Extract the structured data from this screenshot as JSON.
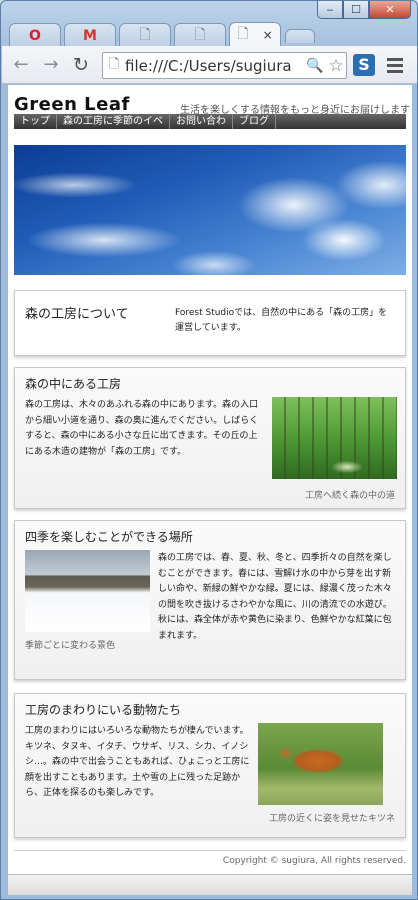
{
  "browser": {
    "tabs": [
      {
        "icon": "opera-icon"
      },
      {
        "icon": "gmail-icon"
      },
      {
        "icon": "page-icon"
      },
      {
        "icon": "page-icon"
      },
      {
        "icon": "page-icon",
        "active": true
      },
      {
        "icon": "new-tab"
      }
    ],
    "tab_close": "×",
    "address": "file:///C:/Users/sugiura",
    "window_buttons": {
      "minimize": "‒",
      "maximize": "☐",
      "close": "✕"
    }
  },
  "site": {
    "logo": "Green Leaf",
    "tagline": "生活を楽しくする情報をもっと身近にお届けします",
    "nav": [
      "トップ",
      "森の工房に季節のイベ",
      "お問い合わ",
      "ブログ"
    ]
  },
  "hero": {
    "icon": "sky-clouds-image"
  },
  "about": {
    "title": "森の工房について",
    "text": "Forest Studioでは、自然の中にある「森の工房」を運営しています。"
  },
  "forest": {
    "title": "森の中にある工房",
    "text": "森の工房は、木々のあふれる森の中にあります。森の入口から細い小道を通り、森の奥に進んでください。しばらくすると、森の中にある小さな丘に出てきます。その丘の上にある木造の建物が「森の工房」です。",
    "caption": "工房へ続く森の中の道"
  },
  "seasons": {
    "title": "四季を楽しむことができる場所",
    "text": "森の工房では、春、夏、秋、冬と、四季折々の自然を楽しむことができます。春には、雪解け水の中から芽を出す新しい命や、新緑の鮮やかな緑。夏には、緑濃く茂った木々の間を吹き抜けるさわやかな風に、川の清流での水遊び。秋には、森全体が赤や黄色に染まり、色鮮やかな紅葉に包まれます。",
    "caption": "季節ごとに変わる景色"
  },
  "animals": {
    "title": "工房のまわりにいる動物たち",
    "text": "工房のまわりにはいろいろな動物たちが棲んでいます。キツネ、タヌキ、イタチ、ウサギ、リス、シカ、イノシシ…。森の中で出会うこともあれば、ひょこっと工房に顔を出すこともあります。土や雪の上に残った足跡から、正体を探るのも楽しみです。",
    "caption": "工房の近くに姿を見せたキツネ"
  },
  "footer": "Copyright © sugiura, All rights reserved."
}
